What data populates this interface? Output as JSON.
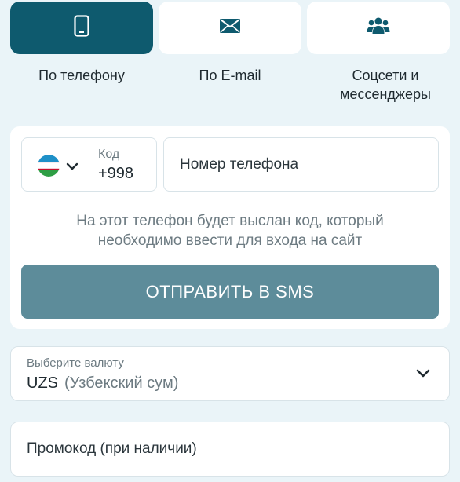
{
  "tabs": [
    {
      "label": "По телефону",
      "icon": "phone-icon",
      "active": true
    },
    {
      "label": "По E-mail",
      "icon": "envelope-icon",
      "active": false
    },
    {
      "label": "Соцсети и мессенджеры",
      "icon": "users-icon",
      "active": false
    }
  ],
  "phone_form": {
    "country_flag": "uzbekistan-flag-icon",
    "code_caption": "Код",
    "code_value": "+998",
    "phone_placeholder": "Номер телефона",
    "hint": "На этот телефон будет выслан код, который необходимо ввести для входа на сайт",
    "submit_label": "ОТПРАВИТЬ В SMS"
  },
  "currency": {
    "caption": "Выберите валюту",
    "code": "UZS",
    "name": "(Узбекский сум)"
  },
  "promo": {
    "placeholder": "Промокод (при наличии)"
  },
  "colors": {
    "background": "#eaf4f8",
    "active_tab": "#0e5a6e",
    "button": "#5d8c9a",
    "muted_text": "#6d7b82"
  }
}
